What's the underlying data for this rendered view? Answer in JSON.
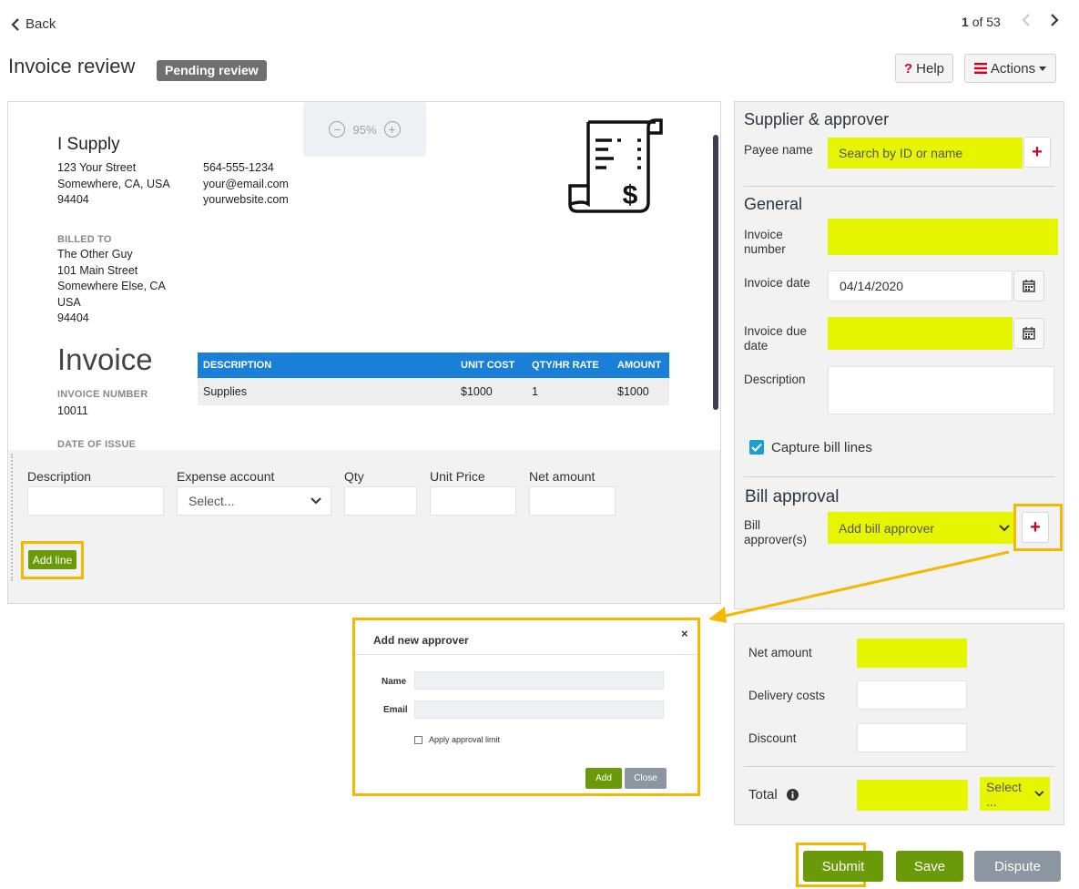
{
  "header": {
    "back_label": "Back",
    "pager_current": "1",
    "pager_total": "of 53",
    "title": "Invoice review",
    "status_badge": "Pending review",
    "help_label": "Help",
    "actions_label": "Actions"
  },
  "viewer": {
    "zoom": "95%",
    "supplier_name": "I Supply",
    "supplier_address": [
      "123 Your Street",
      "Somewhere, CA, USA",
      "94404"
    ],
    "supplier_contact": [
      "564-555-1234",
      "your@email.com",
      "yourwebsite.com"
    ],
    "billed_to_label": "BILLED TO",
    "billed_to": [
      "The Other Guy",
      "101 Main Street",
      "Somewhere Else, CA",
      "USA",
      "94404"
    ],
    "invoice_heading": "Invoice",
    "invoice_number_label": "INVOICE NUMBER",
    "invoice_number": "10011",
    "date_of_issue_label": "DATE OF ISSUE",
    "table_headers": [
      "DESCRIPTION",
      "UNIT COST",
      "QTY/HR RATE",
      "AMOUNT"
    ],
    "table_rows": [
      [
        "Supplies",
        "$1000",
        "1",
        "$1000"
      ]
    ]
  },
  "bill_lines": {
    "description_label": "Description",
    "expense_account_label": "Expense account",
    "expense_account_placeholder": "Select...",
    "qty_label": "Qty",
    "unit_price_label": "Unit Price",
    "net_amount_label": "Net amount",
    "add_line_label": "Add line"
  },
  "panel": {
    "supplier_section": "Supplier & approver",
    "payee_label": "Payee name",
    "payee_placeholder": "Search by ID or name",
    "general_section": "General",
    "invoice_number_label": "Invoice number",
    "invoice_date_label": "Invoice date",
    "invoice_date_value": "04/14/2020",
    "invoice_due_date_label": "Invoice due date",
    "description_label": "Description",
    "capture_lines_label": "Capture bill lines",
    "bill_approval_section": "Bill approval",
    "bill_approvers_label": "Bill approver(s)",
    "bill_approvers_placeholder": "Add bill approver"
  },
  "totals": {
    "net_amount_label": "Net amount",
    "delivery_costs_label": "Delivery costs",
    "discount_label": "Discount",
    "total_label": "Total",
    "currency_placeholder": "Select ..."
  },
  "modal": {
    "title": "Add new approver",
    "name_label": "Name",
    "email_label": "Email",
    "approval_limit_label": "Apply approval limit",
    "add_label": "Add",
    "close_label": "Close"
  },
  "footer": {
    "submit_label": "Submit",
    "save_label": "Save",
    "dispute_label": "Dispute"
  },
  "colors": {
    "accent_green": "#6a9a0a",
    "highlight_yellow": "#e6f500",
    "callout_orange": "#f5b800",
    "table_blue": "#1a7fd6"
  }
}
